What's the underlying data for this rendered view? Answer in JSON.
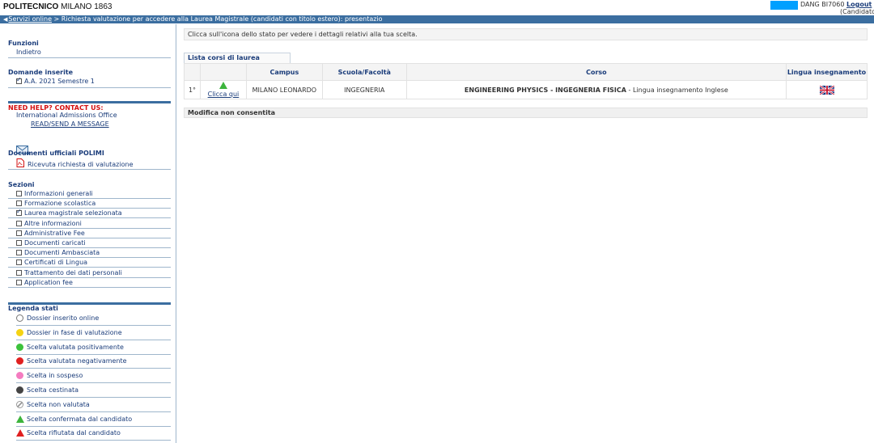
{
  "header": {
    "brand_bold": "POLITECNICO",
    "brand_rest": " MILANO 1863",
    "user_name": "DANG BI7060",
    "logout": "Logout",
    "role": "(Candidato)"
  },
  "breadcrumb": {
    "link": "Servizi online",
    "rest": " > Richiesta valutazione per accedere alla Laurea Magistrale (candidati con titolo estero): presentazio"
  },
  "sidebar": {
    "funzioni_title": "Funzioni",
    "indietro": "Indietro",
    "domande_title": "Domande inserite",
    "domanda_item": "A.A. 2021 Semestre 1",
    "help_title": "NEED HELP? CONTACT US:",
    "help_office": "International Admissions Office",
    "help_link": "READ/SEND A MESSAGE",
    "documenti_title": "Documenti ufficiali POLIMI",
    "documenti_item": "Ricevuta richiesta di valutazione",
    "sezioni_title": "Sezioni",
    "sezioni": [
      {
        "label": "Informazioni generali",
        "checked": false
      },
      {
        "label": "Formazione scolastica",
        "checked": false
      },
      {
        "label": "Laurea magistrale selezionata",
        "checked": true
      },
      {
        "label": "Altre informazioni",
        "checked": false
      },
      {
        "label": "Administrative Fee",
        "checked": false
      },
      {
        "label": "Documenti caricati",
        "checked": false
      },
      {
        "label": "Documenti Ambasciata",
        "checked": false
      },
      {
        "label": "Certificati di Lingua",
        "checked": false
      },
      {
        "label": "Trattamento dei dati personali",
        "checked": false
      },
      {
        "label": "Application fee",
        "checked": false
      }
    ],
    "legenda_title": "Legenda stati",
    "legenda": [
      {
        "label": "Dossier inserito online",
        "shape": "ring",
        "color": "#777777"
      },
      {
        "label": "Dossier in fase di valutazione",
        "shape": "dot",
        "color": "#f5d314"
      },
      {
        "label": "Scelta valutata positivamente",
        "shape": "dot",
        "color": "#3cc23c"
      },
      {
        "label": "Scelta valutata negativamente",
        "shape": "dot",
        "color": "#e02020"
      },
      {
        "label": "Scelta in sospeso",
        "shape": "dot",
        "color": "#f47cc0"
      },
      {
        "label": "Scelta cestinata",
        "shape": "dot",
        "color": "#444444"
      },
      {
        "label": "Scelta non valutata",
        "shape": "slash",
        "color": "#999999"
      },
      {
        "label": "Scelta confermata dal candidato",
        "shape": "tri",
        "color": "#3cb43c"
      },
      {
        "label": "Scelta rifiutata dal candidato",
        "shape": "tri",
        "color": "#e02020"
      }
    ]
  },
  "main": {
    "notice": "Clicca sull'icona dello stato per vedere i dettagli relativi alla tua scelta.",
    "tab": "Lista corsi di laurea magistrale",
    "columns": {
      "campus": "Campus",
      "scuola": "Scuola/Facoltà",
      "corso": "Corso",
      "lingua": "Lingua insegnamento"
    },
    "row": {
      "num": "1°",
      "status_link": "Clicca qui",
      "campus": "MILANO LEONARDO",
      "scuola": "INGEGNERIA",
      "corso_bold": "ENGINEERING PHYSICS - INGEGNERIA FISICA",
      "corso_rest": " -  Lingua insegnamento Inglese"
    },
    "note": "Modifica non consentita"
  },
  "colors": {
    "accent": "#3b6ea0",
    "link": "#1a3c7a",
    "user_box": "#00a0ff"
  }
}
